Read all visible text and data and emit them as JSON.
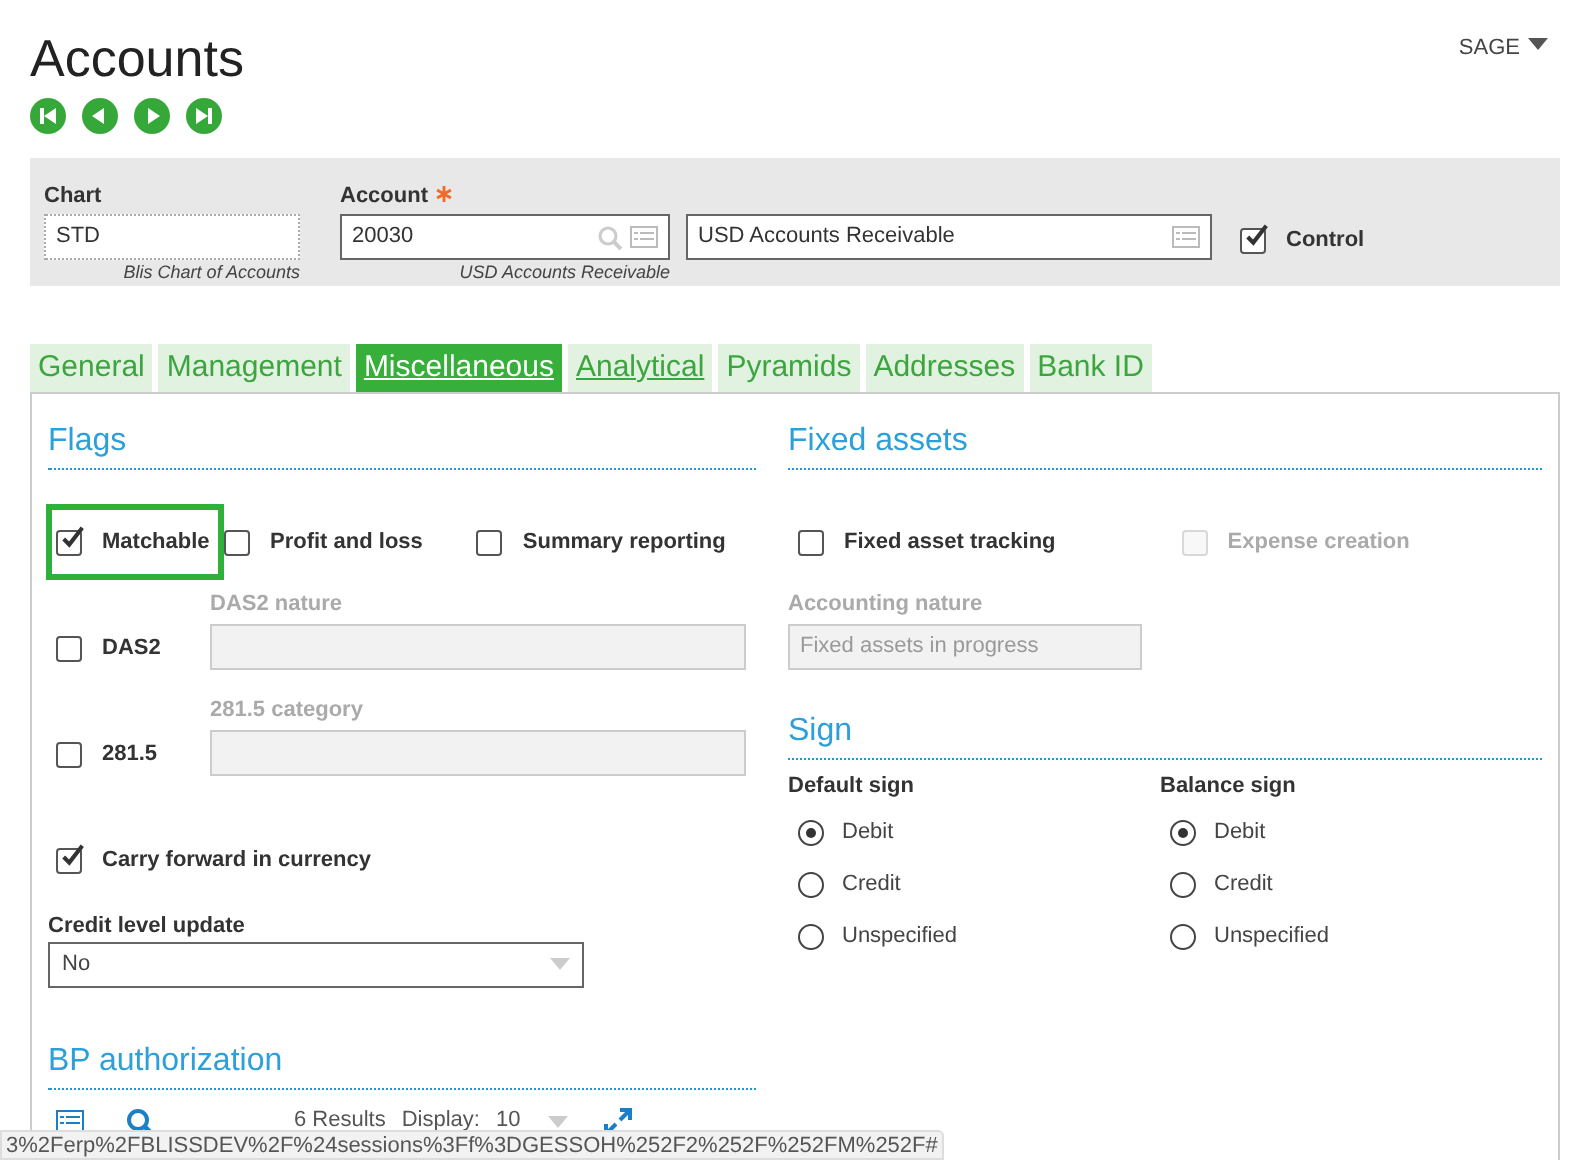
{
  "header": {
    "title": "Accounts",
    "user_menu": "SAGE"
  },
  "key_panel": {
    "chart": {
      "label": "Chart",
      "value": "STD",
      "caption": "Blis Chart of Accounts"
    },
    "account": {
      "label": "Account",
      "required": true,
      "value": "20030",
      "caption": "USD Accounts Receivable"
    },
    "description": {
      "value": "USD Accounts Receivable"
    },
    "control": {
      "label": "Control",
      "checked": true
    }
  },
  "tabs": [
    {
      "label": "General",
      "selected": false,
      "underlined": false
    },
    {
      "label": "Management",
      "selected": false,
      "underlined": false
    },
    {
      "label": "Miscellaneous",
      "selected": true,
      "underlined": true
    },
    {
      "label": "Analytical",
      "selected": false,
      "underlined": true
    },
    {
      "label": "Pyramids",
      "selected": false,
      "underlined": false
    },
    {
      "label": "Addresses",
      "selected": false,
      "underlined": false
    },
    {
      "label": "Bank ID",
      "selected": false,
      "underlined": false
    }
  ],
  "flags": {
    "title": "Flags",
    "checkboxes": [
      {
        "label": "Matchable",
        "checked": true,
        "focused": true
      },
      {
        "label": "Profit and loss",
        "checked": false,
        "focused": false
      },
      {
        "label": "Summary reporting",
        "checked": false,
        "focused": false
      }
    ],
    "das2": {
      "label": "DAS2",
      "checked": false,
      "field_label": "DAS2 nature"
    },
    "c2815": {
      "label": "281.5",
      "checked": false,
      "field_label": "281.5 category"
    },
    "carry_forward": {
      "label": "Carry forward in currency",
      "checked": true
    },
    "credit_level": {
      "label": "Credit level update",
      "value": "No"
    }
  },
  "fixed_assets": {
    "title": "Fixed assets",
    "checkboxes": [
      {
        "label": "Fixed asset tracking",
        "checked": false,
        "disabled": false
      },
      {
        "label": "Expense creation",
        "checked": false,
        "disabled": true
      }
    ],
    "accounting_nature": {
      "label": "Accounting nature",
      "value": "Fixed assets in progress"
    }
  },
  "sign": {
    "title": "Sign",
    "groups": [
      {
        "label": "Default sign",
        "options": [
          {
            "label": "Debit",
            "selected": true
          },
          {
            "label": "Credit",
            "selected": false
          },
          {
            "label": "Unspecified",
            "selected": false
          }
        ]
      },
      {
        "label": "Balance sign",
        "options": [
          {
            "label": "Debit",
            "selected": true
          },
          {
            "label": "Credit",
            "selected": false
          },
          {
            "label": "Unspecified",
            "selected": false
          }
        ]
      }
    ]
  },
  "bp_authorization": {
    "title": "BP authorization",
    "results": "6 Results",
    "display_label": "Display:",
    "display_value": "10"
  },
  "status_bar": {
    "url": "3%2Ferp%2FBLISSDEV%2F%24sessions%3Ff%3DGESSOH%252F2%252F%252FM%252F#"
  }
}
